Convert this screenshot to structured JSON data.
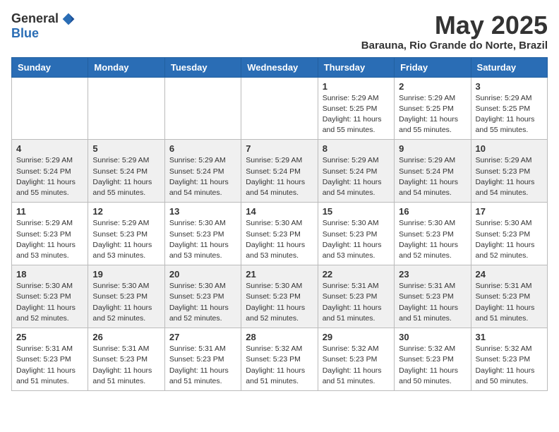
{
  "logo": {
    "general": "General",
    "blue": "Blue"
  },
  "title": {
    "month": "May 2025",
    "location": "Barauna, Rio Grande do Norte, Brazil"
  },
  "headers": [
    "Sunday",
    "Monday",
    "Tuesday",
    "Wednesday",
    "Thursday",
    "Friday",
    "Saturday"
  ],
  "weeks": [
    [
      {
        "day": "",
        "info": ""
      },
      {
        "day": "",
        "info": ""
      },
      {
        "day": "",
        "info": ""
      },
      {
        "day": "",
        "info": ""
      },
      {
        "day": "1",
        "info": "Sunrise: 5:29 AM\nSunset: 5:25 PM\nDaylight: 11 hours\nand 55 minutes."
      },
      {
        "day": "2",
        "info": "Sunrise: 5:29 AM\nSunset: 5:25 PM\nDaylight: 11 hours\nand 55 minutes."
      },
      {
        "day": "3",
        "info": "Sunrise: 5:29 AM\nSunset: 5:25 PM\nDaylight: 11 hours\nand 55 minutes."
      }
    ],
    [
      {
        "day": "4",
        "info": "Sunrise: 5:29 AM\nSunset: 5:24 PM\nDaylight: 11 hours\nand 55 minutes."
      },
      {
        "day": "5",
        "info": "Sunrise: 5:29 AM\nSunset: 5:24 PM\nDaylight: 11 hours\nand 55 minutes."
      },
      {
        "day": "6",
        "info": "Sunrise: 5:29 AM\nSunset: 5:24 PM\nDaylight: 11 hours\nand 54 minutes."
      },
      {
        "day": "7",
        "info": "Sunrise: 5:29 AM\nSunset: 5:24 PM\nDaylight: 11 hours\nand 54 minutes."
      },
      {
        "day": "8",
        "info": "Sunrise: 5:29 AM\nSunset: 5:24 PM\nDaylight: 11 hours\nand 54 minutes."
      },
      {
        "day": "9",
        "info": "Sunrise: 5:29 AM\nSunset: 5:24 PM\nDaylight: 11 hours\nand 54 minutes."
      },
      {
        "day": "10",
        "info": "Sunrise: 5:29 AM\nSunset: 5:23 PM\nDaylight: 11 hours\nand 54 minutes."
      }
    ],
    [
      {
        "day": "11",
        "info": "Sunrise: 5:29 AM\nSunset: 5:23 PM\nDaylight: 11 hours\nand 53 minutes."
      },
      {
        "day": "12",
        "info": "Sunrise: 5:29 AM\nSunset: 5:23 PM\nDaylight: 11 hours\nand 53 minutes."
      },
      {
        "day": "13",
        "info": "Sunrise: 5:30 AM\nSunset: 5:23 PM\nDaylight: 11 hours\nand 53 minutes."
      },
      {
        "day": "14",
        "info": "Sunrise: 5:30 AM\nSunset: 5:23 PM\nDaylight: 11 hours\nand 53 minutes."
      },
      {
        "day": "15",
        "info": "Sunrise: 5:30 AM\nSunset: 5:23 PM\nDaylight: 11 hours\nand 53 minutes."
      },
      {
        "day": "16",
        "info": "Sunrise: 5:30 AM\nSunset: 5:23 PM\nDaylight: 11 hours\nand 52 minutes."
      },
      {
        "day": "17",
        "info": "Sunrise: 5:30 AM\nSunset: 5:23 PM\nDaylight: 11 hours\nand 52 minutes."
      }
    ],
    [
      {
        "day": "18",
        "info": "Sunrise: 5:30 AM\nSunset: 5:23 PM\nDaylight: 11 hours\nand 52 minutes."
      },
      {
        "day": "19",
        "info": "Sunrise: 5:30 AM\nSunset: 5:23 PM\nDaylight: 11 hours\nand 52 minutes."
      },
      {
        "day": "20",
        "info": "Sunrise: 5:30 AM\nSunset: 5:23 PM\nDaylight: 11 hours\nand 52 minutes."
      },
      {
        "day": "21",
        "info": "Sunrise: 5:30 AM\nSunset: 5:23 PM\nDaylight: 11 hours\nand 52 minutes."
      },
      {
        "day": "22",
        "info": "Sunrise: 5:31 AM\nSunset: 5:23 PM\nDaylight: 11 hours\nand 51 minutes."
      },
      {
        "day": "23",
        "info": "Sunrise: 5:31 AM\nSunset: 5:23 PM\nDaylight: 11 hours\nand 51 minutes."
      },
      {
        "day": "24",
        "info": "Sunrise: 5:31 AM\nSunset: 5:23 PM\nDaylight: 11 hours\nand 51 minutes."
      }
    ],
    [
      {
        "day": "25",
        "info": "Sunrise: 5:31 AM\nSunset: 5:23 PM\nDaylight: 11 hours\nand 51 minutes."
      },
      {
        "day": "26",
        "info": "Sunrise: 5:31 AM\nSunset: 5:23 PM\nDaylight: 11 hours\nand 51 minutes."
      },
      {
        "day": "27",
        "info": "Sunrise: 5:31 AM\nSunset: 5:23 PM\nDaylight: 11 hours\nand 51 minutes."
      },
      {
        "day": "28",
        "info": "Sunrise: 5:32 AM\nSunset: 5:23 PM\nDaylight: 11 hours\nand 51 minutes."
      },
      {
        "day": "29",
        "info": "Sunrise: 5:32 AM\nSunset: 5:23 PM\nDaylight: 11 hours\nand 51 minutes."
      },
      {
        "day": "30",
        "info": "Sunrise: 5:32 AM\nSunset: 5:23 PM\nDaylight: 11 hours\nand 50 minutes."
      },
      {
        "day": "31",
        "info": "Sunrise: 5:32 AM\nSunset: 5:23 PM\nDaylight: 11 hours\nand 50 minutes."
      }
    ]
  ]
}
